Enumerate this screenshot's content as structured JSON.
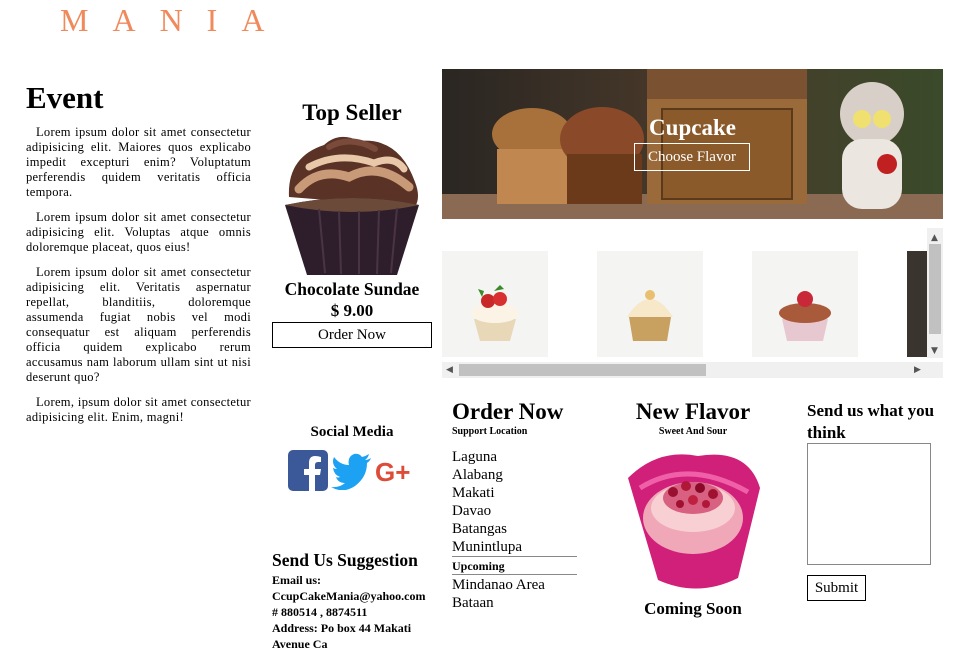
{
  "logo": {
    "text": "MANIA"
  },
  "event": {
    "title": "Event",
    "paragraphs": [
      "Lorem ipsum dolor sit amet consectetur adipisicing elit. Maiores quos explicabo impedit excepturi enim? Voluptatum perferendis quidem veritatis officia tempora.",
      "Lorem ipsum dolor sit amet consectetur adipisicing elit. Voluptas atque omnis doloremque placeat, quos eius!",
      "Lorem ipsum dolor sit amet consectetur adipisicing elit. Veritatis aspernatur repellat, blanditiis, doloremque assumenda fugiat nobis vel modi consequatur est aliquam perferendis officia quidem explicabo rerum accusamus nam laborum ullam sint ut nisi deserunt quo?",
      "Lorem, ipsum dolor sit amet consectetur adipisicing elit. Enim, magni!"
    ]
  },
  "top_seller": {
    "title": "Top Seller",
    "name": "Chocolate Sundae",
    "price": "$ 9.00",
    "button": "Order Now"
  },
  "social": {
    "title": "Social Media",
    "icons": [
      "facebook-icon",
      "twitter-icon",
      "google-plus-icon"
    ],
    "gplus_text": "G+"
  },
  "suggestion": {
    "title": "Send Us Suggestion",
    "email_label": "Email us:",
    "email": "CcupCakeMania@yahoo.com",
    "phone": "# 880514 , 8874511",
    "address": "Address: Po box 44 Makati Avenue Ca"
  },
  "hero": {
    "title": "Cupcake",
    "button": "Choose Flavor"
  },
  "order_now": {
    "title": "Order Now",
    "subtitle": "Support Location",
    "locations": [
      "Laguna",
      "Alabang",
      "Makati",
      "Davao",
      "Batangas",
      "Munintlupa"
    ],
    "upcoming_label": "Upcoming",
    "upcoming": [
      "Mindanao Area",
      "Bataan"
    ]
  },
  "new_flavor": {
    "title": "New Flavor",
    "subtitle": "Sweet And Sour",
    "status": "Coming Soon"
  },
  "feedback": {
    "title": "Send us what you think",
    "button": "Submit"
  },
  "colors": {
    "logo": "#f08a5d",
    "facebook": "#3b5998",
    "twitter": "#1da1f2",
    "google_plus": "#dd4b39"
  }
}
